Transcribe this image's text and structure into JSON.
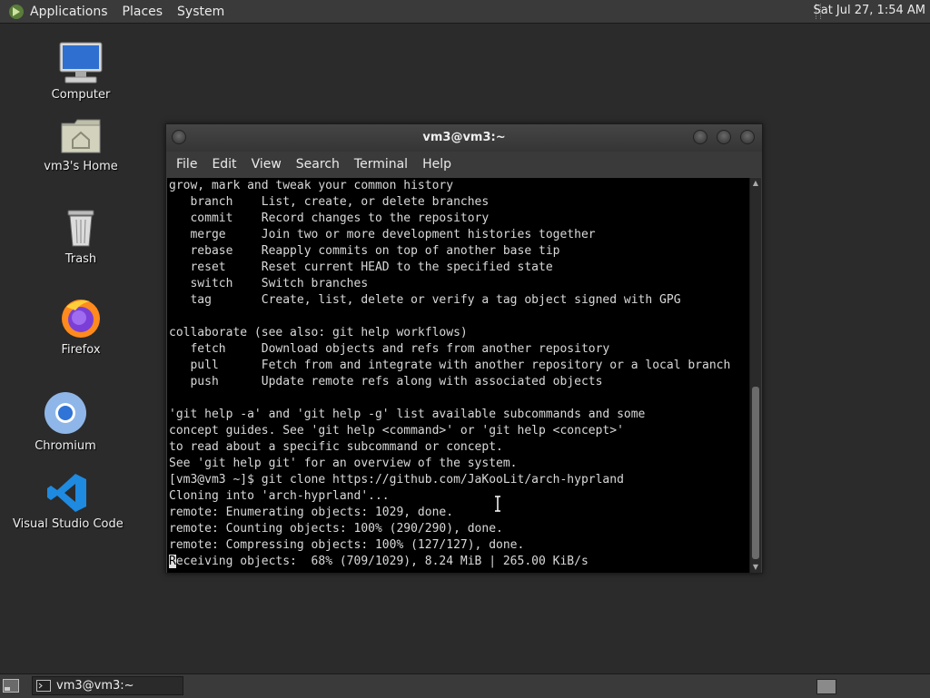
{
  "top_panel": {
    "menus": [
      "Applications",
      "Places",
      "System"
    ],
    "clock": "Sat Jul 27,  1:54 AM"
  },
  "desktop": {
    "icons": [
      {
        "label": "Computer",
        "icon": "computer-icon"
      },
      {
        "label": "vm3's Home",
        "icon": "home-folder-icon"
      },
      {
        "label": "Trash",
        "icon": "trash-icon"
      },
      {
        "label": "Firefox",
        "icon": "firefox-icon"
      },
      {
        "label": "Chromium",
        "icon": "chromium-icon"
      },
      {
        "label": "Visual Studio Code",
        "icon": "vscode-icon"
      }
    ]
  },
  "terminal_window": {
    "title": "vm3@vm3:~",
    "menu": [
      "File",
      "Edit",
      "View",
      "Search",
      "Terminal",
      "Help"
    ],
    "lines": [
      "grow, mark and tweak your common history",
      "   branch    List, create, or delete branches",
      "   commit    Record changes to the repository",
      "   merge     Join two or more development histories together",
      "   rebase    Reapply commits on top of another base tip",
      "   reset     Reset current HEAD to the specified state",
      "   switch    Switch branches",
      "   tag       Create, list, delete or verify a tag object signed with GPG",
      "",
      "collaborate (see also: git help workflows)",
      "   fetch     Download objects and refs from another repository",
      "   pull      Fetch from and integrate with another repository or a local branch",
      "   push      Update remote refs along with associated objects",
      "",
      "'git help -a' and 'git help -g' list available subcommands and some",
      "concept guides. See 'git help <command>' or 'git help <concept>'",
      "to read about a specific subcommand or concept.",
      "See 'git help git' for an overview of the system.",
      "[vm3@vm3 ~]$ git clone https://github.com/JaKooLit/arch-hyprland",
      "Cloning into 'arch-hyprland'...",
      "remote: Enumerating objects: 1029, done.",
      "remote: Counting objects: 100% (290/290), done.",
      "remote: Compressing objects: 100% (127/127), done."
    ],
    "last_line_cursor_char": "R",
    "last_line_rest": "eceiving objects:  68% (709/1029), 8.24 MiB | 265.00 KiB/s"
  },
  "bottom_panel": {
    "task": "vm3@vm3:~"
  },
  "colors": {
    "panel": "#3a3a3a",
    "desktop": "#2b2b2b",
    "terminal_bg": "#000000",
    "terminal_fg": "#d9d9d9"
  }
}
